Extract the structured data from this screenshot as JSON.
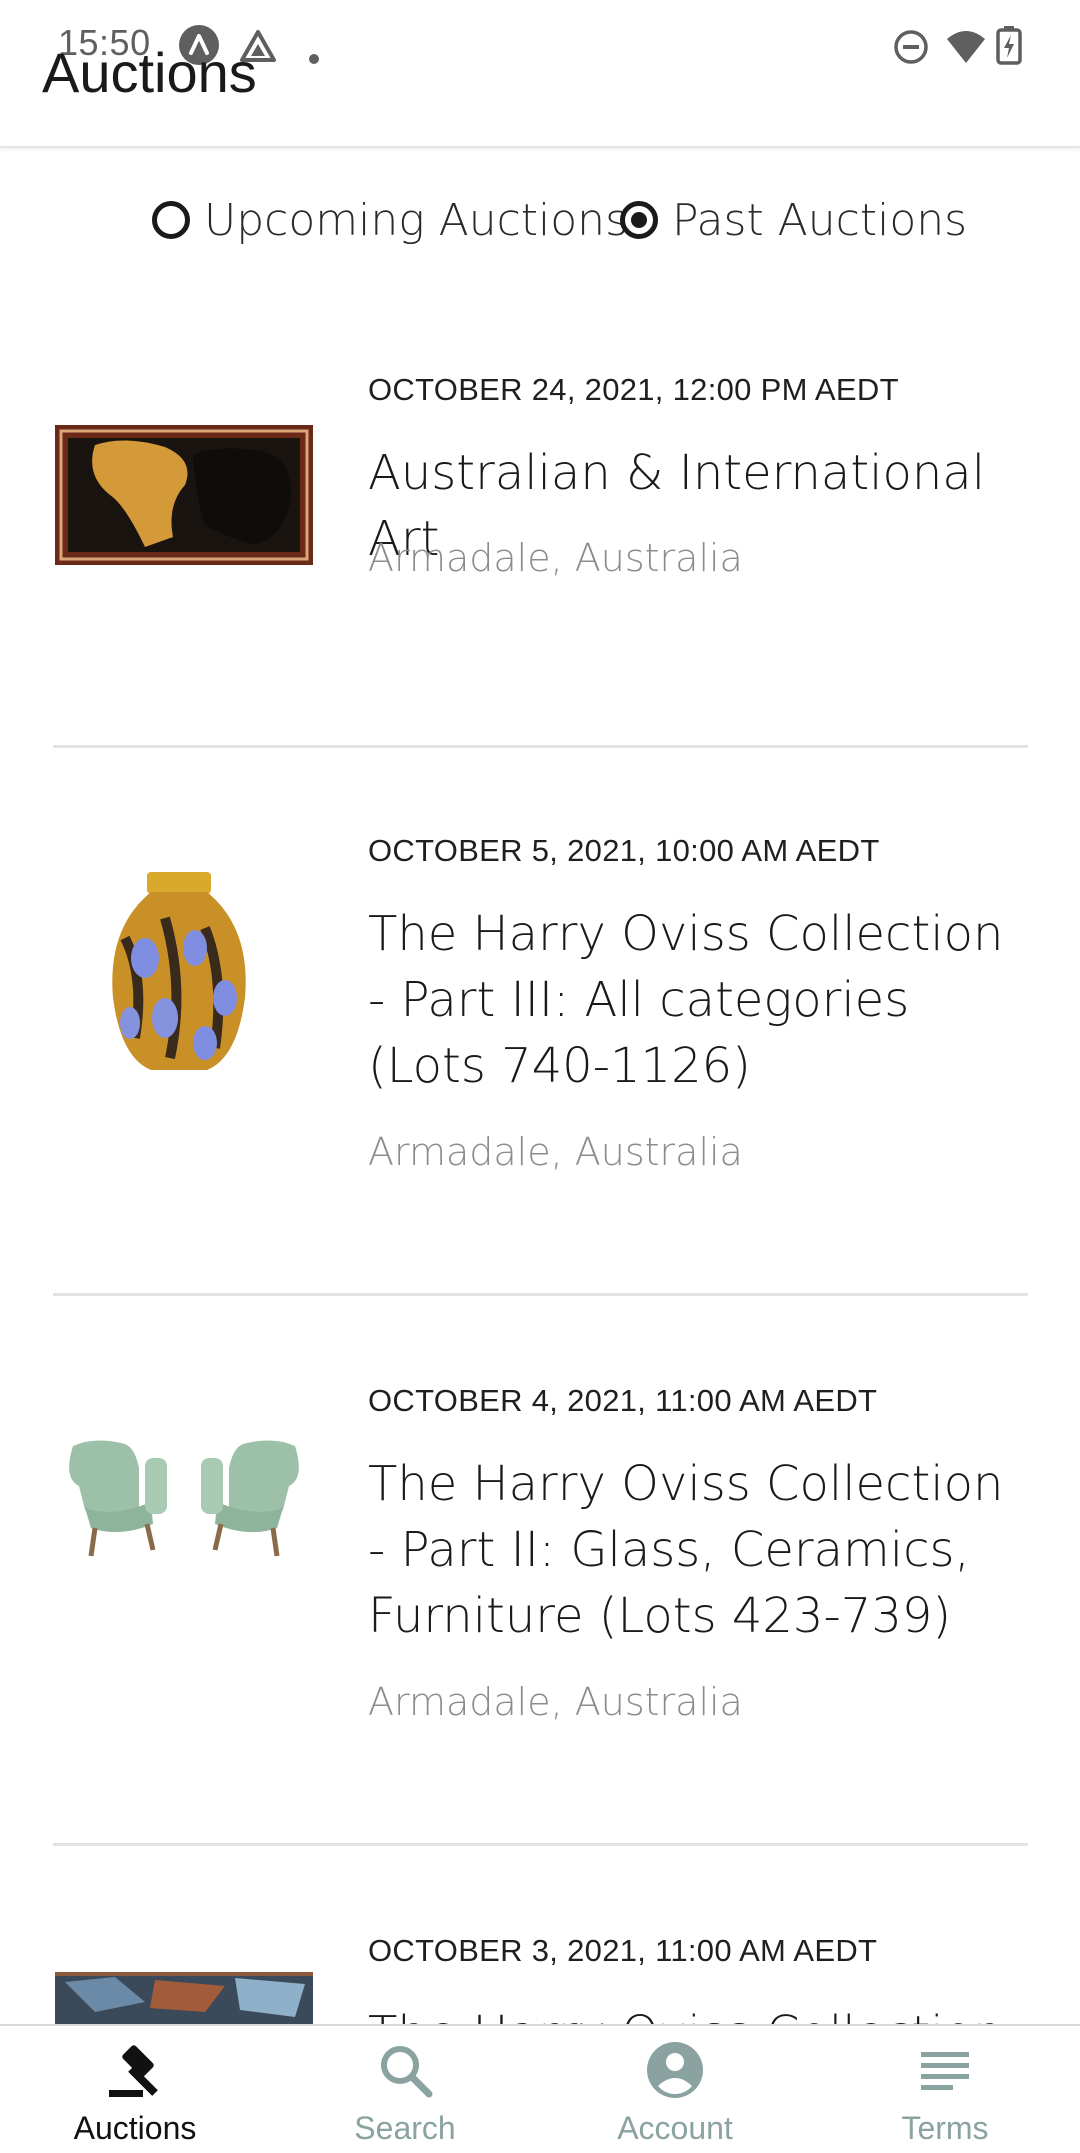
{
  "status_bar": {
    "time": "15:50"
  },
  "app_bar": {
    "title": "Auctions"
  },
  "filter": {
    "options": [
      {
        "label": "Upcoming Auctions",
        "selected": false
      },
      {
        "label": "Past Auctions",
        "selected": true
      }
    ]
  },
  "auctions": [
    {
      "date": "OCTOBER 24, 2021, 12:00 PM AEDT",
      "title": "Australian & International Art",
      "location": "Armadale, Australia",
      "image": "abstract-painting-thumbnail"
    },
    {
      "date": "OCTOBER 5, 2021, 10:00 AM AEDT",
      "title": "The Harry Oviss Collection - Part III: All categories (Lots 740-1126)",
      "location": "Armadale, Australia",
      "image": "glass-vase-thumbnail"
    },
    {
      "date": "OCTOBER 4, 2021, 11:00 AM AEDT",
      "title": "The Harry Oviss Collection - Part II: Glass, Ceramics, Furniture (Lots 423-739)",
      "location": "Armadale, Australia",
      "image": "armchairs-thumbnail"
    },
    {
      "date": "OCTOBER 3, 2021, 11:00 AM AEDT",
      "title": "The Harry Oviss Collection",
      "location": "",
      "image": "painting-thumbnail"
    }
  ],
  "bottom_nav": {
    "items": [
      {
        "label": "Auctions",
        "icon": "gavel-icon",
        "active": true
      },
      {
        "label": "Search",
        "icon": "search-icon",
        "active": false
      },
      {
        "label": "Account",
        "icon": "account-icon",
        "active": false
      },
      {
        "label": "Terms",
        "icon": "terms-icon",
        "active": false
      }
    ]
  },
  "colors": {
    "accent": "#8aa3a1",
    "text": "#1a1a1a",
    "secondary_text": "#8c8c8c",
    "divider": "#e3e3e3"
  }
}
